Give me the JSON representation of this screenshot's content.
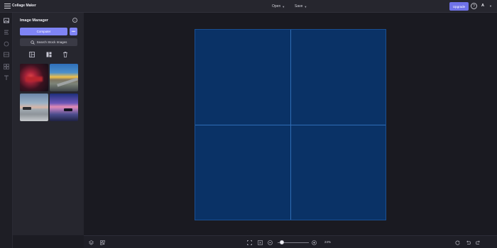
{
  "header": {
    "app_title": "Collage Maker",
    "menus": [
      {
        "label": "Open"
      },
      {
        "label": "Save"
      }
    ],
    "upgrade_label": "Upgrade",
    "help_symbol": "?",
    "avatar_letter": "A"
  },
  "rail": {
    "icons": [
      "images-icon",
      "layers-icon",
      "shapes-icon",
      "layout-icon",
      "elements-icon",
      "text-icon"
    ]
  },
  "panel": {
    "title": "Image Manager",
    "info_symbol": "i",
    "computer_label": "Computer",
    "more_symbol": "•••",
    "search_stock_label": "Search Stock Images",
    "images": [
      {
        "icon": "photo-lantern"
      },
      {
        "icon": "photo-road-sunset"
      },
      {
        "icon": "photo-beach-dusk"
      },
      {
        "icon": "photo-purple-sunset"
      }
    ]
  },
  "canvas": {
    "background": "#0a3266",
    "grid_rows": 2,
    "grid_cols": 2
  },
  "footer": {
    "zoom_percent": 24,
    "zoom_label": "24%"
  },
  "colors": {
    "accent": "#7f84f5",
    "upgrade": "#6f72e8",
    "canvas_line": "#2e6db7"
  }
}
